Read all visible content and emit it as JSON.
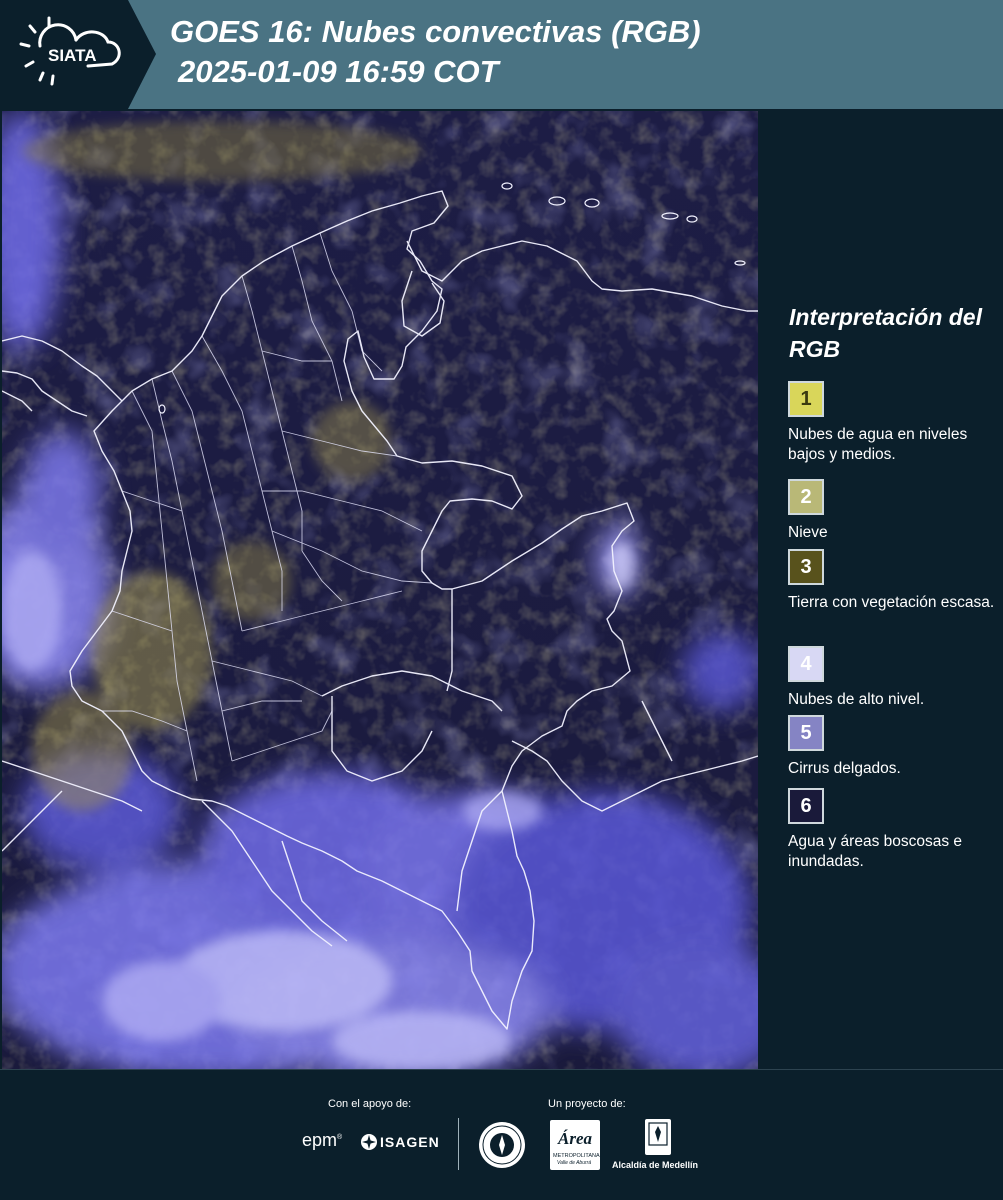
{
  "header": {
    "logo_text": "SIATA",
    "title_line1": "GOES 16: Nubes convectivas (RGB)",
    "title_line2": "2025-01-09 16:59 COT"
  },
  "legend": {
    "title": "Interpretación del RGB",
    "items": [
      {
        "number": "1",
        "label": "Nubes de agua en niveles bajos y medios.",
        "color": "#d9d65a",
        "text_color": "#3a3a10"
      },
      {
        "number": "2",
        "label": "Nieve",
        "color": "#b9b877",
        "text_color": "#ffffff"
      },
      {
        "number": "3",
        "label": "Tierra con vegetación escasa.",
        "color": "#58521c",
        "text_color": "#ffffff"
      },
      {
        "number": "4",
        "label": "Nubes de alto nivel.",
        "color": "#d8d8f4",
        "text_color": "#ffffff"
      },
      {
        "number": "5",
        "label": "Cirrus delgados.",
        "color": "#8584c4",
        "text_color": "#ffffff"
      },
      {
        "number": "6",
        "label": "Agua y áreas boscosas e inundadas.",
        "color": "#1a1a3a",
        "text_color": "#ffffff"
      }
    ]
  },
  "footer": {
    "support_label": "Con el apoyo de:",
    "project_label": "Un proyecto de:",
    "sponsors": [
      "epm",
      "ISAGEN"
    ],
    "partners": [
      "Área Metropolitana Valle de Aburrá",
      "Alcaldía de Medellín"
    ],
    "partner_area_text": "Área",
    "partner_area_sub": "METROPOLITANA",
    "partner_area_sub2": "Valle de Aburrá",
    "partner_alcaldia": "Alcaldía de Medellín"
  },
  "colors": {
    "header_bg": "#4a7383",
    "logo_bg": "#0b1f2b",
    "page_bg": "#0b1f2b",
    "map_dark": "#1b1b3d",
    "cloud_high": "#7b78f0",
    "cloud_low": "#b3a65a"
  }
}
